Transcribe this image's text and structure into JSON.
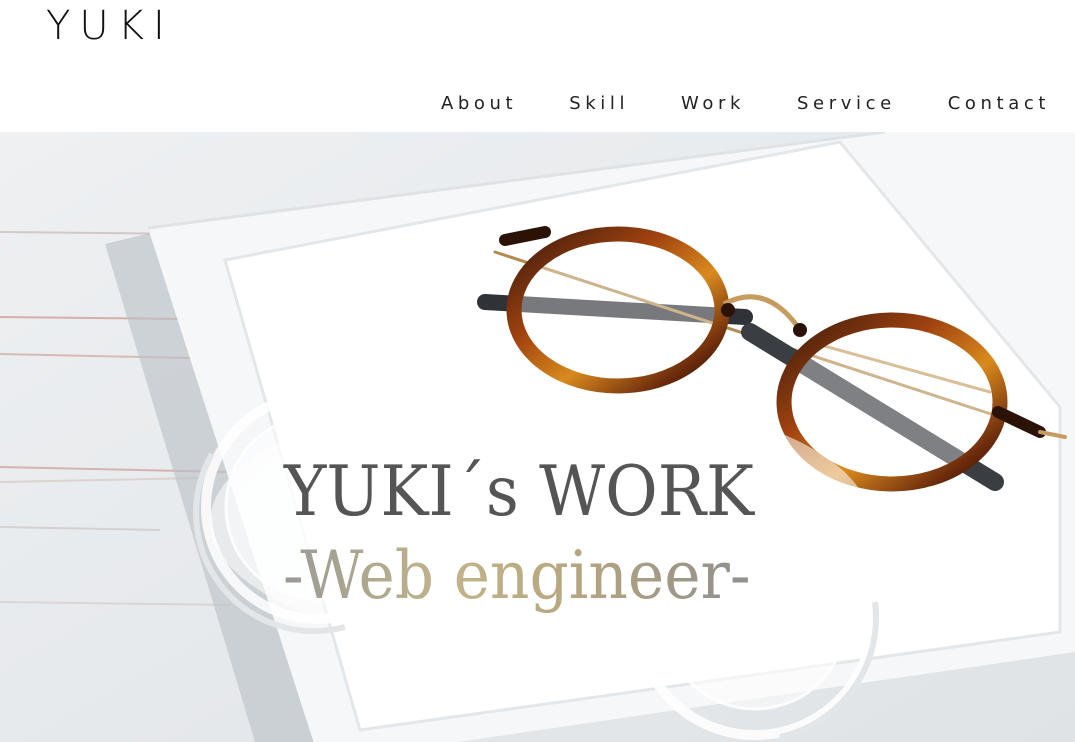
{
  "header": {
    "logo": "YUKI",
    "nav": [
      {
        "label": "About"
      },
      {
        "label": "Skill"
      },
      {
        "label": "Work"
      },
      {
        "label": "Service"
      },
      {
        "label": "Contact"
      }
    ]
  },
  "hero": {
    "title": "YUKI´s WORK",
    "subtitle": "-Web engineer-",
    "image_subject": "glasses-on-white-tray"
  },
  "colors": {
    "text": "#222222",
    "title": "#555555",
    "subtitle_gold": "#c2b48a",
    "background": "#ffffff"
  }
}
